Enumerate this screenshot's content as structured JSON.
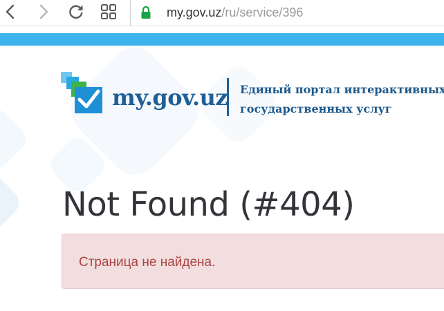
{
  "browser": {
    "url": {
      "host": "my.gov.uz",
      "path": "/ru/service/396"
    },
    "icons": {
      "back": "back-arrow-icon",
      "forward": "forward-arrow-icon",
      "reload": "reload-icon",
      "apps": "apps-grid-icon",
      "lock": "lock-icon"
    }
  },
  "colors": {
    "accent_bar": "#3cb3ec",
    "brand": "#1f5f96",
    "alert_bg": "#f2dede",
    "alert_text": "#a94442"
  },
  "logo": {
    "wordmark": "my.gov.uz",
    "subtitle_line1": "Единый портал интерактивных",
    "subtitle_line2": "государственных услуг"
  },
  "page": {
    "title": "Not Found (#404)",
    "error_message": "Страница не найдена."
  }
}
